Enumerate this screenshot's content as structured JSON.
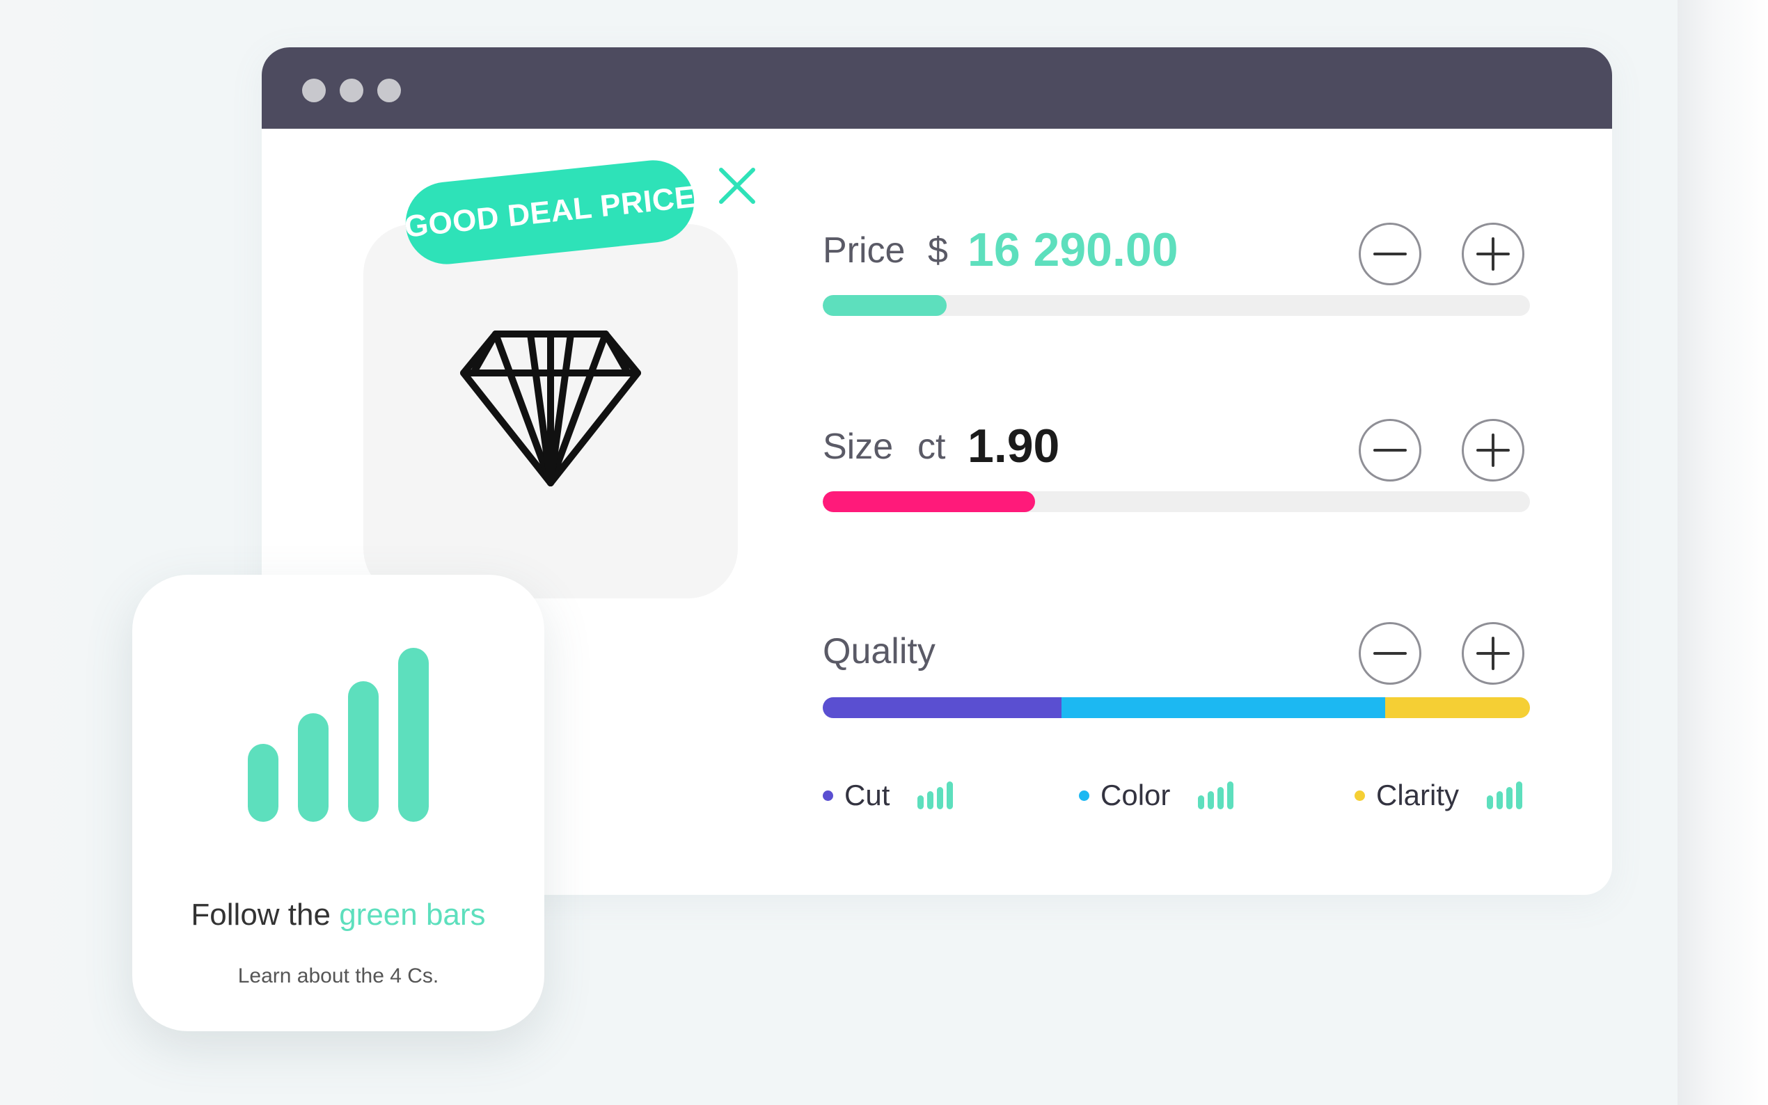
{
  "colors": {
    "teal": "#5ddfbd",
    "badge": "#2ee2b8",
    "pink": "#ff1a7a",
    "purple": "#5a4fd1",
    "blue": "#1cb8f2",
    "yellow": "#f5cf34",
    "titlebar": "#4d4b5f"
  },
  "window": {
    "title_dots": [
      "window-dot",
      "window-dot",
      "window-dot"
    ]
  },
  "badge": {
    "label": "GOOD DEAL PRICE",
    "close_icon": "close-icon"
  },
  "gem": {
    "icon": "diamond-icon"
  },
  "price": {
    "label": "Price",
    "currency": "$",
    "value": "16 290.00",
    "level": 0.175
  },
  "size": {
    "label": "Size",
    "unit": "ct",
    "value": "1.90",
    "level": 0.3
  },
  "quality": {
    "label": "Quality",
    "segments": [
      {
        "name": "Cut",
        "share": 0.338
      },
      {
        "name": "Color",
        "share": 0.457
      },
      {
        "name": "Clarity",
        "share": 0.205
      }
    ]
  },
  "legend": [
    {
      "label": "Cut",
      "dot_color": "#5a4fd1",
      "icon": "signal-bars-icon"
    },
    {
      "label": "Color",
      "dot_color": "#1cb8f2",
      "icon": "signal-bars-icon"
    },
    {
      "label": "Clarity",
      "dot_color": "#f5cf34",
      "icon": "signal-bars-icon"
    }
  ],
  "controls": {
    "minus_icon": "minus-icon",
    "plus_icon": "plus-icon"
  },
  "info_card": {
    "icon": "signal-bars-icon",
    "title_prefix": "Follow the",
    "title_highlight": "green bars",
    "subtitle": "Learn about the 4 Cs."
  }
}
